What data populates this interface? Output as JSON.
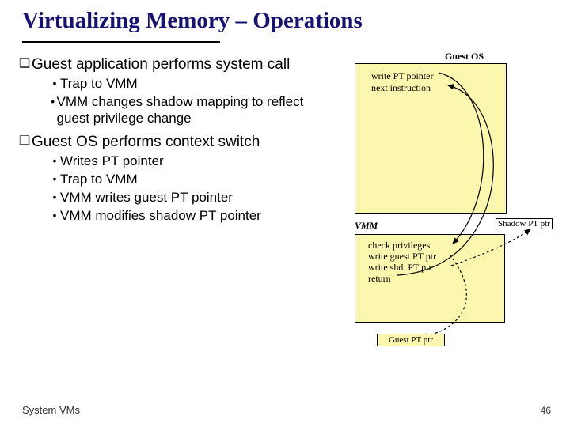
{
  "title": "Virtualizing Memory – Operations",
  "bullets": [
    {
      "label": "Guest application performs system call",
      "sub": [
        "Trap to VMM",
        "VMM changes shadow mapping to reflect guest privilege change"
      ]
    },
    {
      "label": "Guest OS performs context switch",
      "sub": [
        "Writes PT pointer",
        "Trap to VMM",
        "VMM writes guest PT pointer",
        "VMM modifies shadow PT pointer"
      ]
    }
  ],
  "diagram": {
    "guest_os_label": "Guest OS",
    "guest_lines": [
      "write PT pointer",
      "next instruction"
    ],
    "vmm_label": "VMM",
    "shadow_label": "Shadow PT ptr",
    "vmm_lines": [
      "check  privileges",
      "write guest PT ptr",
      "write shd. PT ptr",
      "return"
    ],
    "guest_pt_ptr": "Guest  PT ptr"
  },
  "footer": {
    "left": "System VMs",
    "right": "46"
  }
}
